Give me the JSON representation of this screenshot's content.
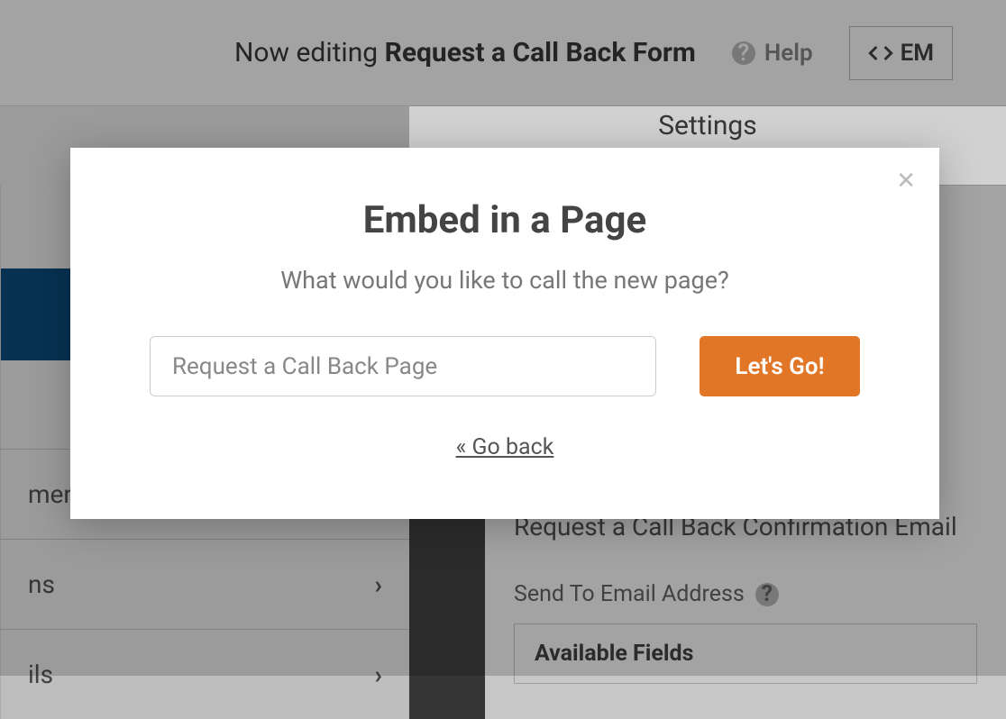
{
  "header": {
    "now_editing_prefix": "Now editing ",
    "form_name": "Request a Call Back Form",
    "help_label": "Help",
    "embed_label": "EM"
  },
  "nav": {
    "settings_tab": "Settings"
  },
  "sidebar": {
    "item_payment_suffix": "ment",
    "item_ns_suffix": "ns",
    "item_ils_suffix": "ils"
  },
  "main": {
    "section_title": "Request a Call Back Confirmation Email",
    "send_to_label": "Send To Email Address",
    "available_fields": "Available Fields"
  },
  "modal": {
    "title": "Embed in a Page",
    "subtitle": "What would you like to call the new page?",
    "input_value": "Request a Call Back Page",
    "go_label": "Let's Go!",
    "back_label": "« Go back"
  }
}
